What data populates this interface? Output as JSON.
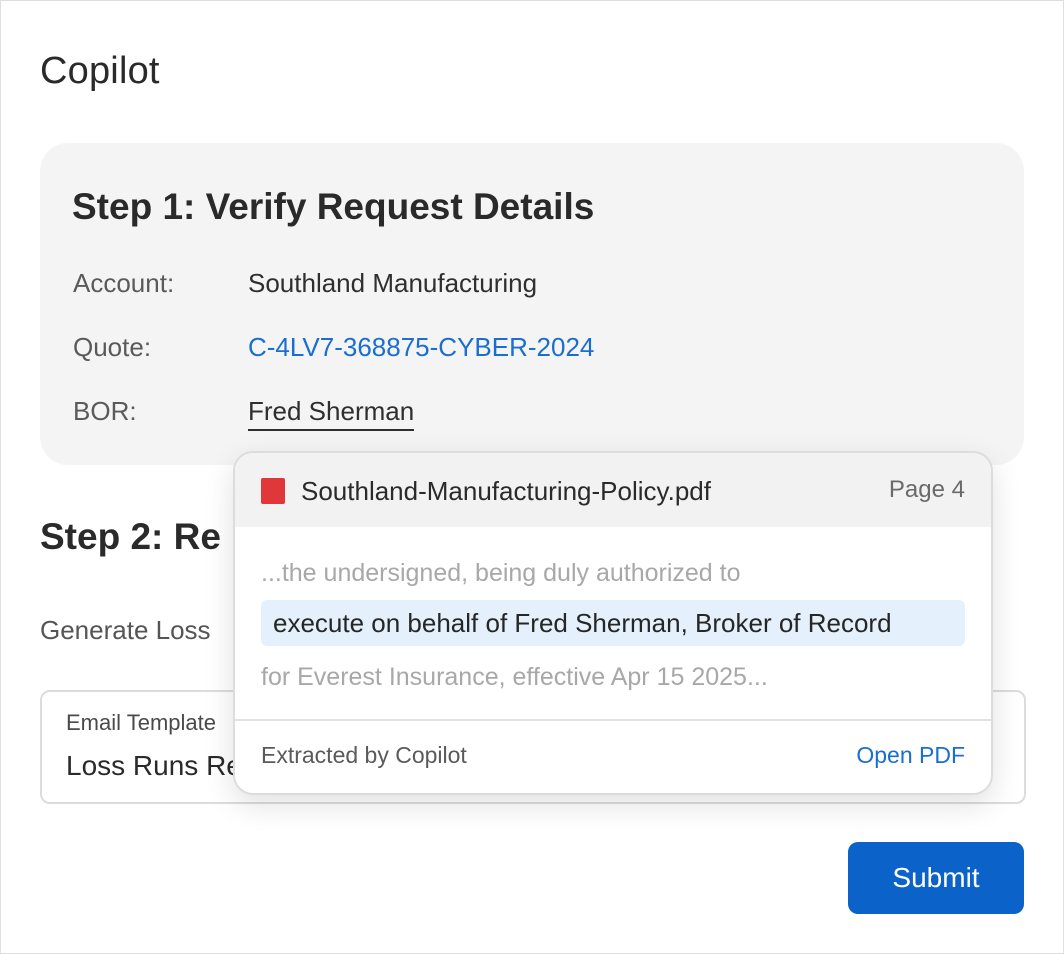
{
  "app": {
    "title": "Copilot"
  },
  "step1": {
    "title": "Step 1: Verify Request Details",
    "account_label": "Account:",
    "account_value": "Southland Manufacturing",
    "quote_label": "Quote:",
    "quote_value": "C-4LV7-368875-CYBER-2024",
    "bor_label": "BOR:",
    "bor_value": "Fred Sherman"
  },
  "step2": {
    "title": "Step 2: Re",
    "description": "Generate Loss",
    "template_label": "Email Template",
    "template_value": "Loss Runs Re",
    "submit_label": "Submit"
  },
  "popover": {
    "file_name": "Southland-Manufacturing-Policy.pdf",
    "page": "Page 4",
    "snippet_before": "...the undersigned, being duly authorized to",
    "snippet_highlight": "execute on behalf of Fred Sherman, Broker of Record",
    "snippet_after": "for Everest Insurance, effective Apr 15 2025...",
    "footer_note": "Extracted by Copilot",
    "open_pdf_label": "Open PDF",
    "icon": "pdf-file-icon"
  },
  "colors": {
    "accent": "#0b62c9",
    "link": "#1a6ecf",
    "pdf_icon": "#e0383a",
    "highlight": "#e4f1fc",
    "card_bg": "#f4f4f4"
  }
}
